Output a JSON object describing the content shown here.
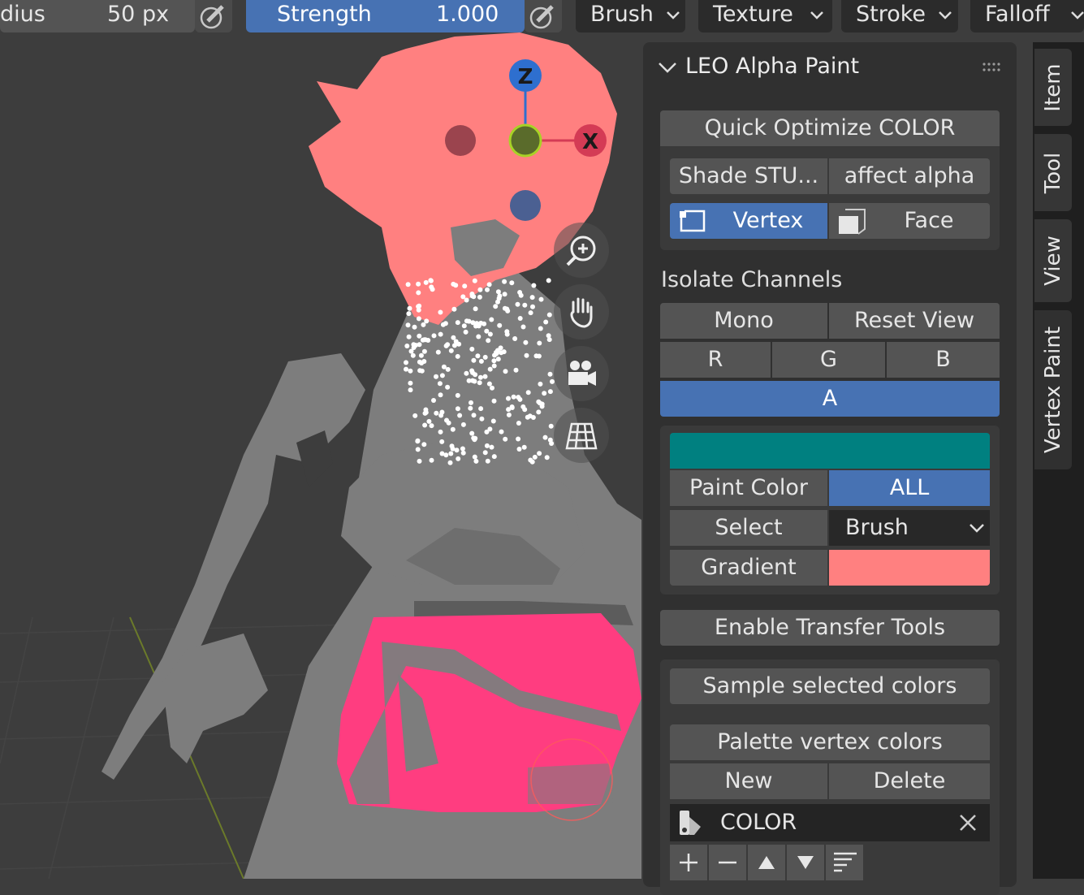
{
  "header": {
    "radius_label": "dius",
    "radius_value": "50 px",
    "strength_label": "Strength",
    "strength_value": "1.000",
    "menus": [
      "Brush",
      "Texture",
      "Stroke",
      "Falloff"
    ]
  },
  "gizmo": {
    "z": "Z",
    "x": "X"
  },
  "panel": {
    "title": "LEO Alpha Paint",
    "quick_optimize": "Quick Optimize COLOR",
    "shade_stu": "Shade STU...",
    "affect_alpha": "affect alpha",
    "vertex": "Vertex",
    "face": "Face",
    "isolate_channels": "Isolate Channels",
    "mono": "Mono",
    "reset_view": "Reset View",
    "r": "R",
    "g": "G",
    "b": "B",
    "a": "A",
    "paint_color_label": "Paint Color",
    "paint_color_value": "ALL",
    "select_label": "Select",
    "select_value": "Brush",
    "gradient_label": "Gradient",
    "enable_transfer": "Enable Transfer Tools",
    "sample_selected": "Sample selected colors",
    "palette_vertex": "Palette vertex colors",
    "new": "New",
    "delete": "Delete",
    "palette_item": "COLOR"
  },
  "colors": {
    "active_blue": "#4772b3",
    "swatch_teal": "#008080",
    "gradient_pink": "#ff8080",
    "hair": "#ff8080",
    "skirt": "#ff3d80"
  },
  "tabs": [
    "Item",
    "Tool",
    "View",
    "Vertex Paint"
  ]
}
